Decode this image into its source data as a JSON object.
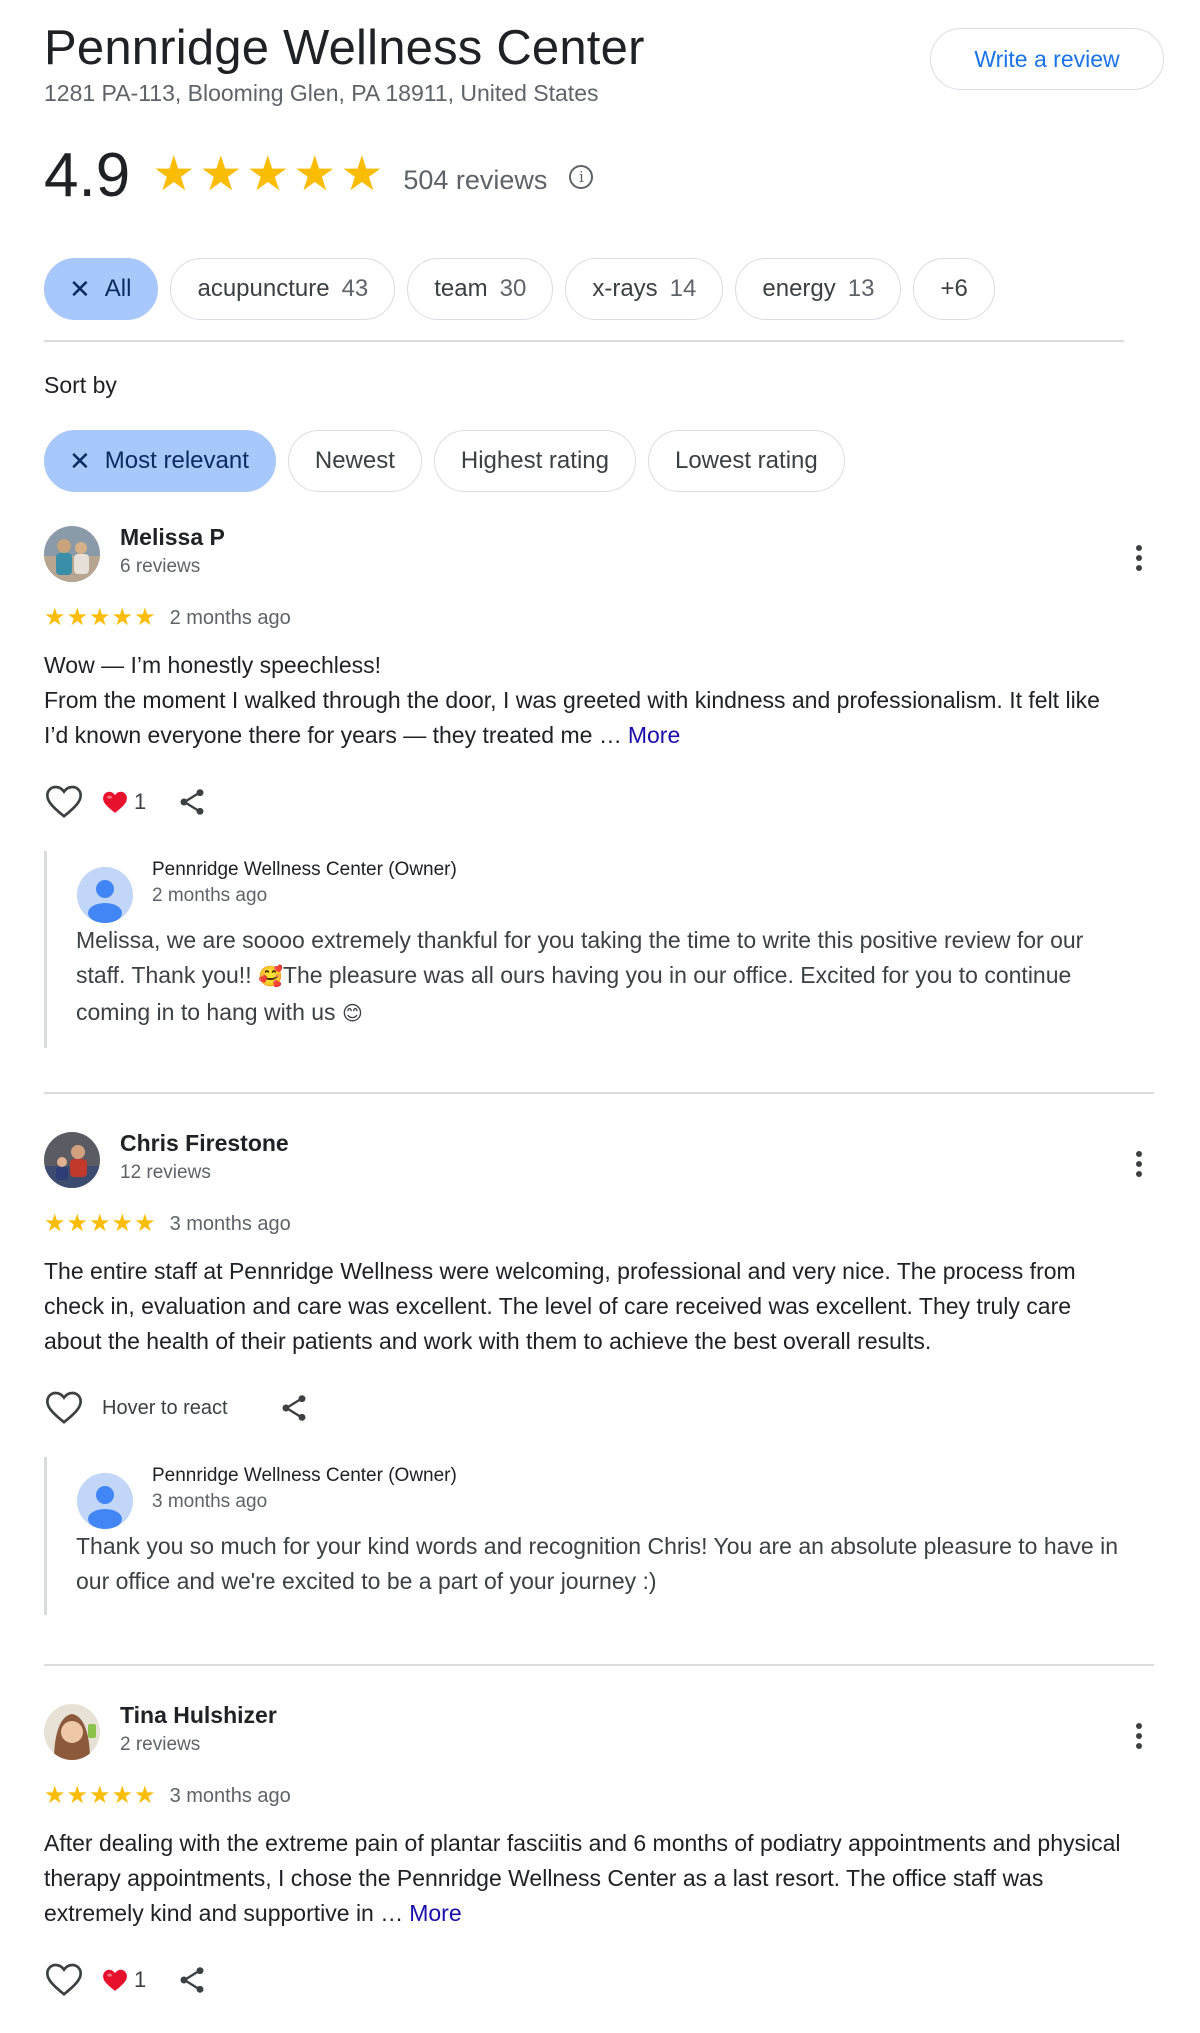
{
  "business": {
    "name": "Pennridge Wellness Center",
    "address": "1281 PA-113, Blooming Glen, PA 18911, United States",
    "write_review_label": "Write a review",
    "rating": "4.9",
    "stars": 5,
    "review_count": "504 reviews",
    "info_icon": "info-icon"
  },
  "topics": [
    {
      "label": "All",
      "count": "",
      "selected": true
    },
    {
      "label": "acupuncture",
      "count": "43"
    },
    {
      "label": "team",
      "count": "30"
    },
    {
      "label": "x-rays",
      "count": "14"
    },
    {
      "label": "energy",
      "count": "13"
    },
    {
      "label": "+6",
      "count": ""
    }
  ],
  "sort": {
    "label": "Sort by",
    "options": [
      {
        "label": "Most relevant",
        "selected": true
      },
      {
        "label": "Newest"
      },
      {
        "label": "Highest rating"
      },
      {
        "label": "Lowest rating"
      }
    ]
  },
  "reviews": [
    {
      "name": "Melissa P",
      "count": "6 reviews",
      "stars": 5,
      "date": "2 months ago",
      "line1": "Wow — I’m honestly speechless!",
      "line2": "From the moment I walked through the door, I was greeted with kindness and professionalism. It felt like I’d known everyone there for years — they treated me …",
      "more": "More",
      "react_count": "1",
      "owner": {
        "name": "Pennridge Wellness Center (Owner)",
        "date": "2 months ago",
        "text_a": "Melissa, we are soooo extremely thankful for you taking the time to write this positive review for our staff. Thank you!! ",
        "emoji_a": "🥰",
        "text_b": "The pleasure was all ours having you in our office. Excited for you to continue coming in to hang with us ",
        "emoji_b": "😊"
      }
    },
    {
      "name": "Chris Firestone",
      "count": "12 reviews",
      "stars": 5,
      "date": "3 months ago",
      "text": "The entire staff at Pennridge Wellness were welcoming, professional and very nice. The process from check in, evaluation and care was excellent. The level of care received was excellent. They truly care about the health of their patients and work with them to achieve the best overall results.",
      "hover_text": "Hover to react",
      "owner": {
        "name": "Pennridge Wellness Center (Owner)",
        "date": "3 months ago",
        "text": "Thank you so much for your kind words and recognition Chris! You are an absolute pleasure to have in our office and we're excited to be a part of your journey :)"
      }
    },
    {
      "name": "Tina Hulshizer",
      "count": "2 reviews",
      "stars": 5,
      "date": "3 months ago",
      "text": "After dealing with the extreme pain of plantar fasciitis and 6 months of podiatry appointments and physical therapy appointments, I chose the Pennridge Wellness Center as a last resort. The office staff was extremely kind and supportive in …",
      "more": "More",
      "react_count": "1"
    }
  ],
  "colors": {
    "star": "#fbbc04",
    "accent": "#1a73e8",
    "chip_selected": "#a8c7fa",
    "link": "#1a0dab",
    "heart": "#e8112d"
  }
}
